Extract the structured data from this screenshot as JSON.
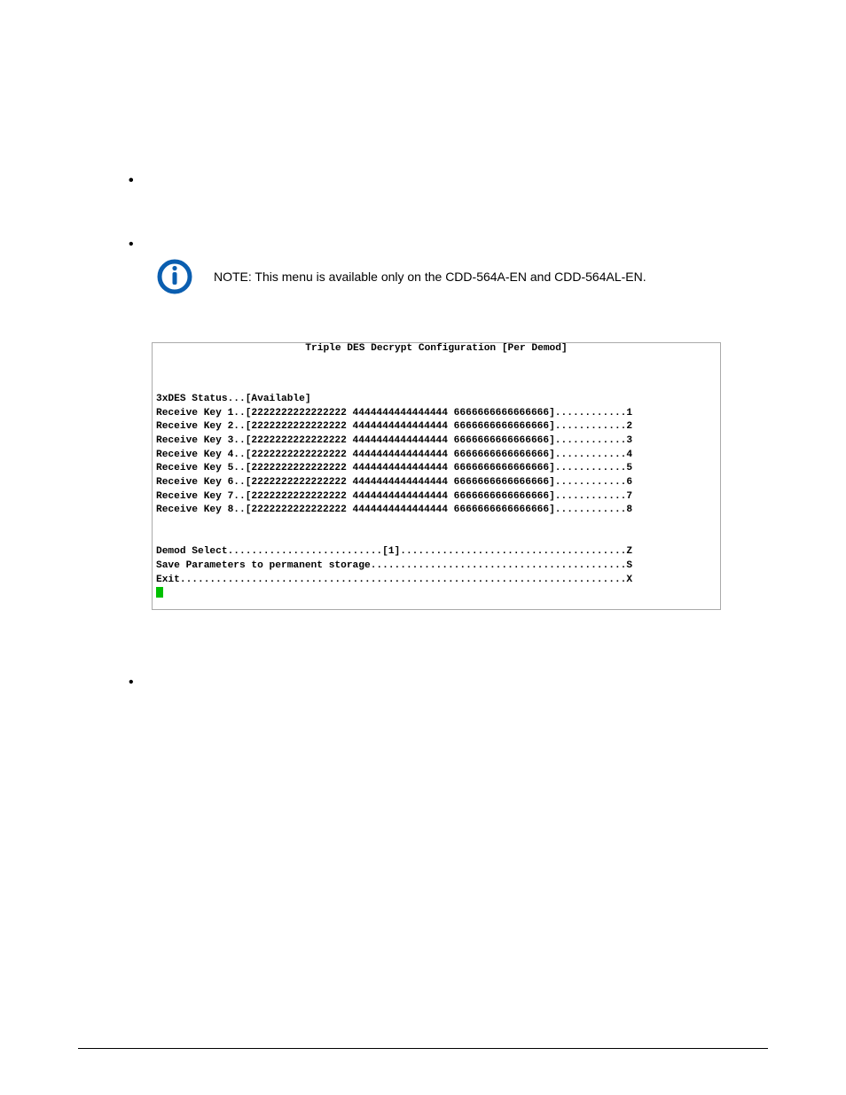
{
  "bullets_top": [
    "",
    "",
    ""
  ],
  "gap_bullet": "",
  "note": {
    "icon_alt": "info-icon",
    "text": "NOTE:  This menu is available only on the CDD-564A-EN and CDD-564AL-EN."
  },
  "terminal": {
    "title": "Triple DES Decrypt Configuration [Per Demod]",
    "status_line": "3xDES Status...[Available]",
    "keys": [
      "Receive Key 1..[2222222222222222 4444444444444444 6666666666666666]............1",
      "Receive Key 2..[2222222222222222 4444444444444444 6666666666666666]............2",
      "Receive Key 3..[2222222222222222 4444444444444444 6666666666666666]............3",
      "Receive Key 4..[2222222222222222 4444444444444444 6666666666666666]............4",
      "Receive Key 5..[2222222222222222 4444444444444444 6666666666666666]............5",
      "Receive Key 6..[2222222222222222 4444444444444444 6666666666666666]............6",
      "Receive Key 7..[2222222222222222 4444444444444444 6666666666666666]............7",
      "Receive Key 8..[2222222222222222 4444444444444444 6666666666666666]............8"
    ],
    "footer_lines": [
      "Demod Select..........................[1]......................................Z",
      "Save Parameters to permanent storage...........................................S",
      "Exit...........................................................................X"
    ]
  },
  "bullets_after": [
    ""
  ]
}
